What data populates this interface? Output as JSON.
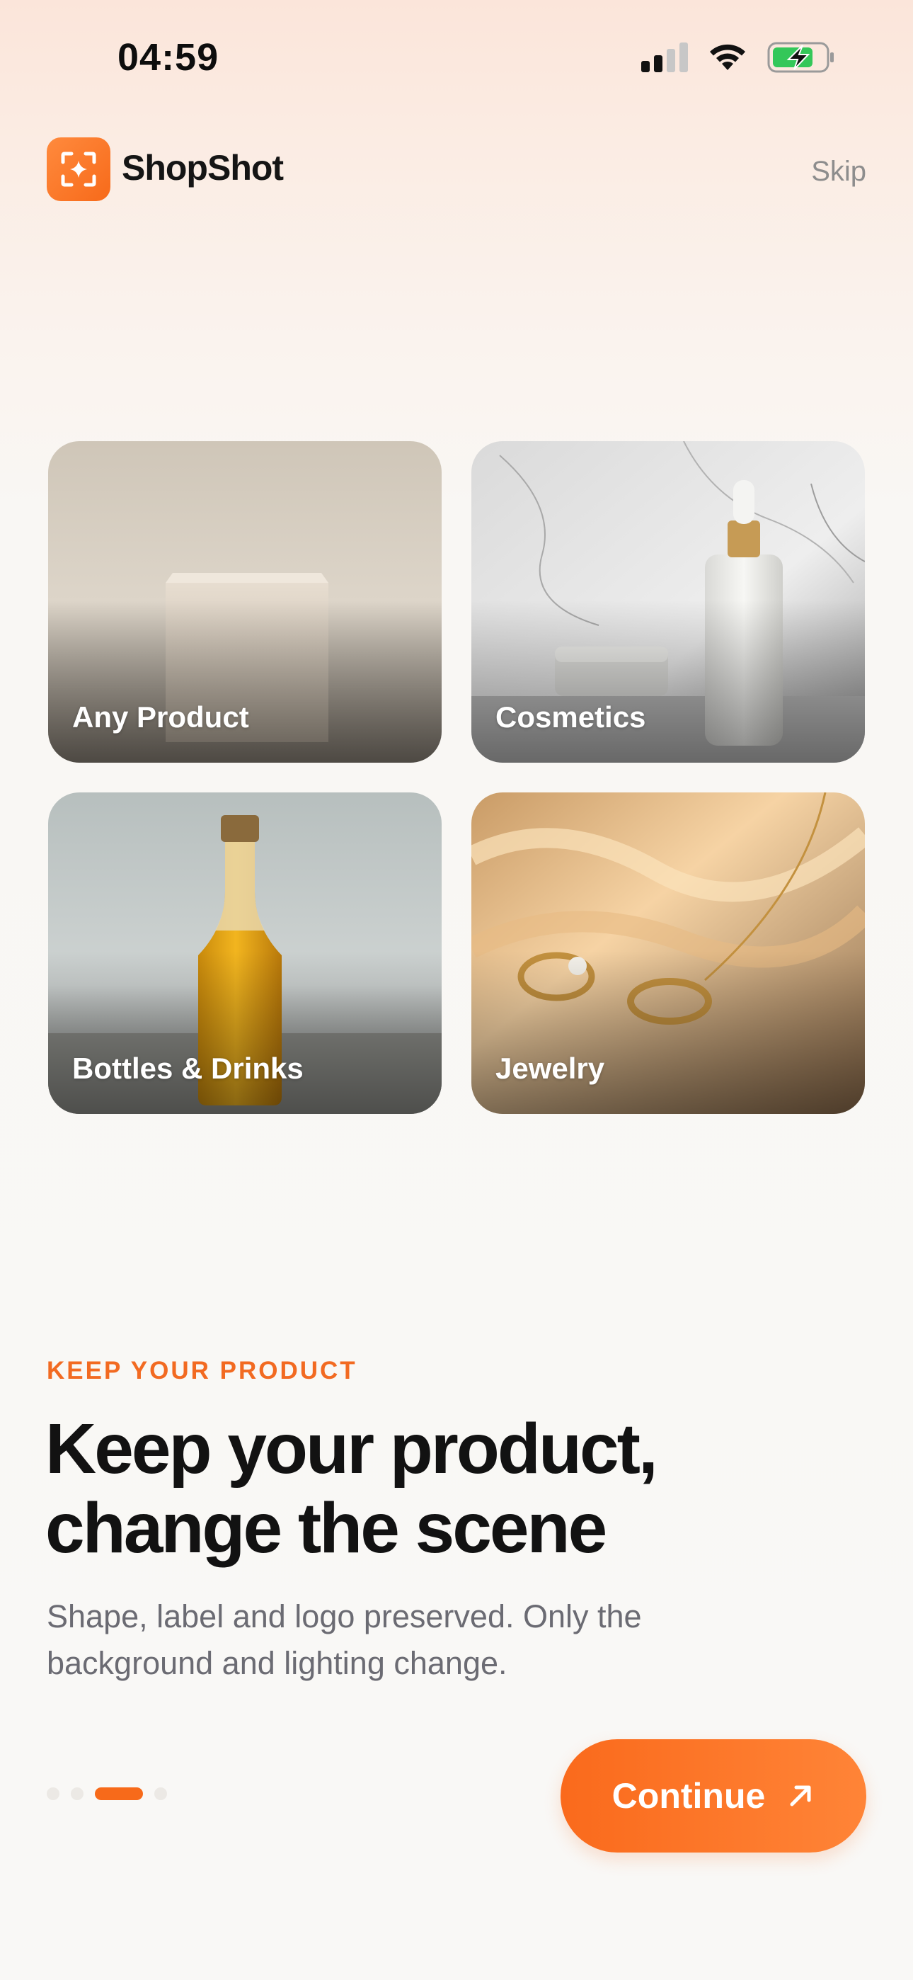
{
  "status_bar": {
    "time": "04:59",
    "icons": [
      "cellular-signal-icon",
      "wifi-icon",
      "battery-charging-icon"
    ]
  },
  "header": {
    "app_name": "ShopShot",
    "logo_icon": "sparkle-frame-icon",
    "skip_label": "Skip"
  },
  "categories": [
    {
      "label": "Any Product"
    },
    {
      "label": "Cosmetics"
    },
    {
      "label": "Bottles & Drinks"
    },
    {
      "label": "Jewelry"
    }
  ],
  "onboarding": {
    "eyebrow": "KEEP YOUR PRODUCT",
    "headline_line1": "Keep your product,",
    "headline_line2": "change the scene",
    "subtext_line1": "Shape, label and logo preserved. Only the",
    "subtext_line2": "background and lighting change."
  },
  "pager": {
    "total": 4,
    "current": 3
  },
  "cta": {
    "label": "Continue",
    "icon": "arrow-up-right-icon"
  },
  "colors": {
    "accent": "#f76a1a",
    "text_primary": "#121212",
    "text_secondary": "#6b6b73"
  }
}
